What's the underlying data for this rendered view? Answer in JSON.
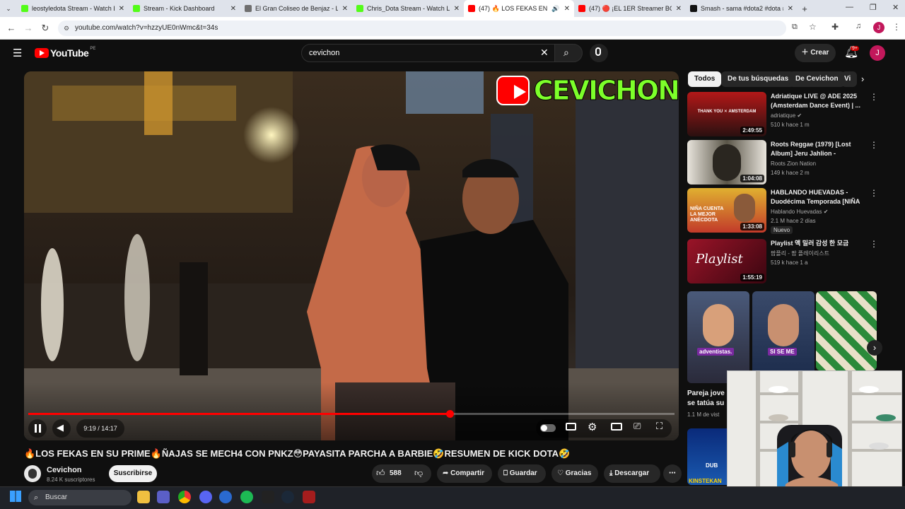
{
  "browser": {
    "tabs": [
      {
        "title": "leostyledota Stream - Watch Liv",
        "color": "#53fc18"
      },
      {
        "title": "Stream - Kick Dashboard",
        "color": "#53fc18"
      },
      {
        "title": "El Gran Coliseo de Benjaz - Liqu",
        "color": "#6f6f6f"
      },
      {
        "title": "Chris_Dota Stream - Watch Live",
        "color": "#53fc18"
      },
      {
        "title": "(47) 🔥 LOS FEKAS EN SU PR",
        "color": "#ff0000",
        "active": true
      },
      {
        "title": "(47) 🔴 ¡EL 1ER Streamer BOTUI",
        "color": "#ff0000"
      },
      {
        "title": "Smash - sama #dota2 #dota #s",
        "color": "#111111"
      }
    ],
    "url": "youtube.com/watch?v=hzzyUE0nWmc&t=34s",
    "profile_initial": "J"
  },
  "youtube": {
    "logo_text": "YouTube",
    "logo_region": "PE",
    "search_value": "cevichon",
    "create_label": "Crear",
    "notif_count": "9+",
    "avatar_initial": "J"
  },
  "player": {
    "overlay_logo_text": "CEVICHON",
    "time_current": "9:19",
    "time_total": "14:17",
    "time_display": "9:19 / 14:17",
    "progress": 0.652
  },
  "video": {
    "title": "🔥LOS FEKAS EN SU PRIME🔥ÑAJAS SE MECH4 CON PNKZ😳PAYASITA PARCHA A BARBIE🤣RESUMEN DE KICK DOTA🤣",
    "channel": "Cevichon",
    "subscribers": "8.24 K suscriptores",
    "subscribe_label": "Suscribirse",
    "likes": "588",
    "share_label": "Compartir",
    "save_label": "Guardar",
    "thanks_label": "Gracias",
    "download_label": "Descargar"
  },
  "chips": [
    "Todos",
    "De tus búsquedas",
    "De Cevichon",
    "Vi"
  ],
  "recommendations": [
    {
      "title": "Adriatique LIVE @ ADE 2025 (Amsterdam Dance Event) | ...",
      "channel": "adriatique",
      "verified": true,
      "meta": "510 k  hace 1 m",
      "duration": "2:49:55",
      "thumb_color": "#8a1a1a",
      "thumb_text": "THANK YOU ✕ AMSTERDAM"
    },
    {
      "title": "Roots Reggae (1979) [Lost Album] Jeru Jahlion - Prophec...",
      "channel": "Roots Zion Nation",
      "verified": false,
      "meta": "149 k  hace 2 m",
      "duration": "1:04:08",
      "thumb_color": "#5a5a4a",
      "thumb_text": ""
    },
    {
      "title": "HABLANDO HUEVADAS - Duodécima Temporada [NIÑA ...",
      "channel": "Hablando Huevadas",
      "verified": true,
      "meta": "2.1 M  hace 2 días",
      "duration": "1:33:08",
      "thumb_color": "#c23a2a",
      "thumb_text": "NIÑA CUENTA LA MEJOR ANÉCDOTA",
      "badge": "Nuevo"
    },
    {
      "title": "Playlist 액 밀러 감성 한 모금",
      "channel": "팝플리 - 팝 플레이리스트",
      "verified": false,
      "meta": "519 k  hace 1 a",
      "duration": "1:55:19",
      "thumb_color": "#7a1020",
      "thumb_text": "Playlist"
    }
  ],
  "shorts": [
    {
      "caption": "adventistas.",
      "color": "#3a4a6a"
    },
    {
      "caption": "SI SE ME",
      "color": "#2a3a5a"
    },
    {
      "caption": "",
      "color": "#2a7a3a"
    }
  ],
  "shorts_title": "Pareja jove se tatúa su",
  "shorts_meta": "1.1 M de vist",
  "shorts_next": "DUB",
  "shorts_next_title": "KINSTEKAN",
  "taskbar": {
    "search_placeholder": "Buscar"
  }
}
